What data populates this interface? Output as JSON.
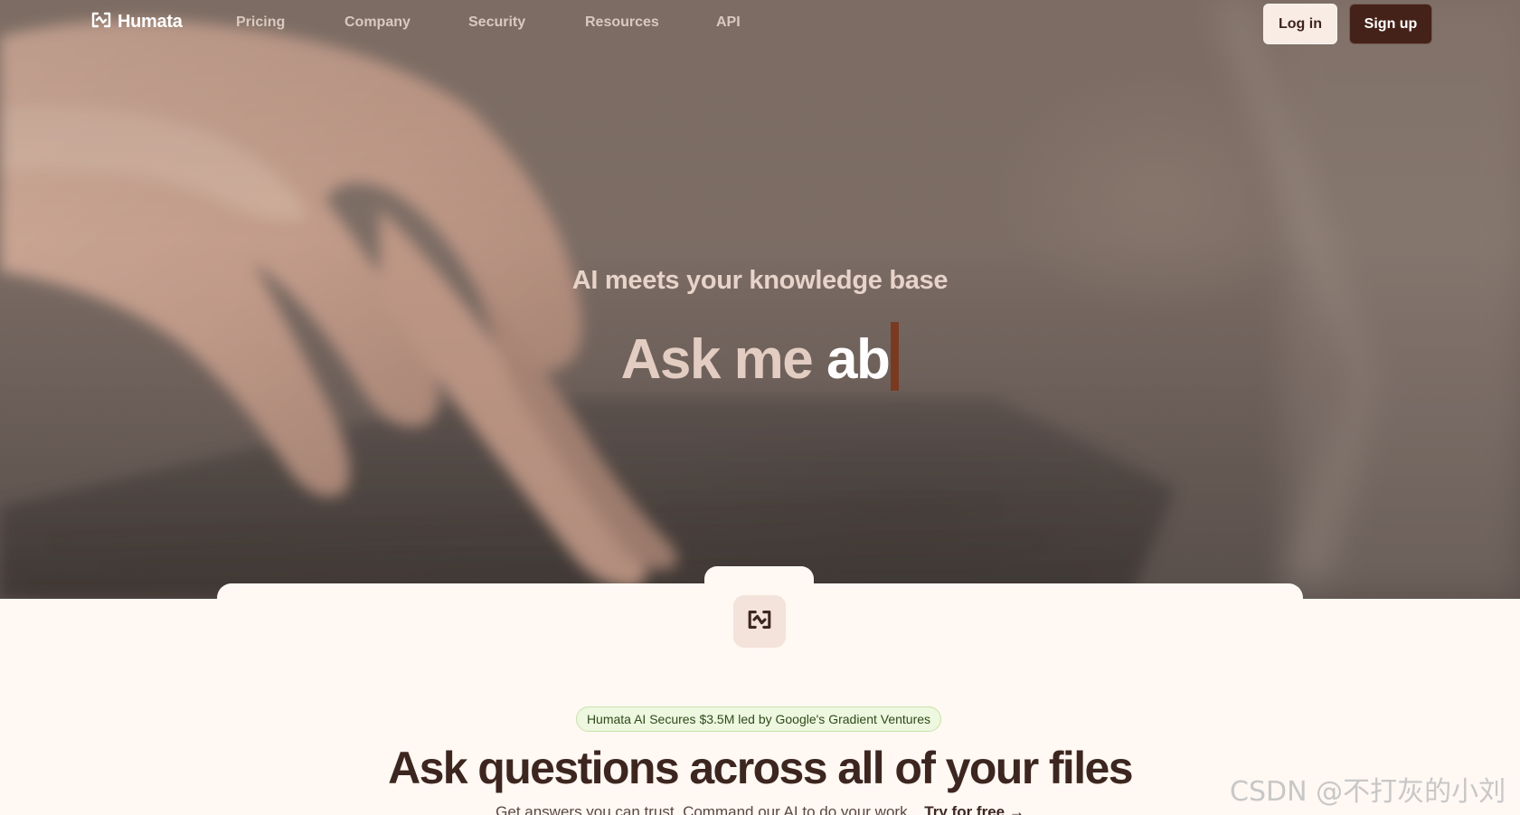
{
  "brand": {
    "name": "Humata"
  },
  "nav": {
    "links": [
      {
        "label": "Pricing"
      },
      {
        "label": "Company"
      },
      {
        "label": "Security"
      },
      {
        "label": "Resources"
      },
      {
        "label": "API"
      }
    ],
    "login_label": "Log in",
    "signup_label": "Sign up"
  },
  "hero": {
    "subtitle": "AI meets your knowledge base",
    "headline_static": "Ask me",
    "headline_typed": "ab"
  },
  "announcement": {
    "text": "Humata AI Secures $3.5M led by Google's Gradient Ventures"
  },
  "section": {
    "title": "Ask questions across all of your files",
    "description": "Get answers you can trust. Command our AI to do your work.",
    "cta": "Try for free →"
  },
  "watermark": {
    "text": "CSDN @不打灰的小刘"
  },
  "colors": {
    "accent_dark": "#452219",
    "login_bg": "#f8ece5",
    "page_bg": "#fff8f3",
    "pill_bg": "#eef7df",
    "caret": "#7a3a22"
  },
  "icons": {
    "logo": "humata-logo-icon",
    "brand_mark": "humata-logo-icon"
  }
}
